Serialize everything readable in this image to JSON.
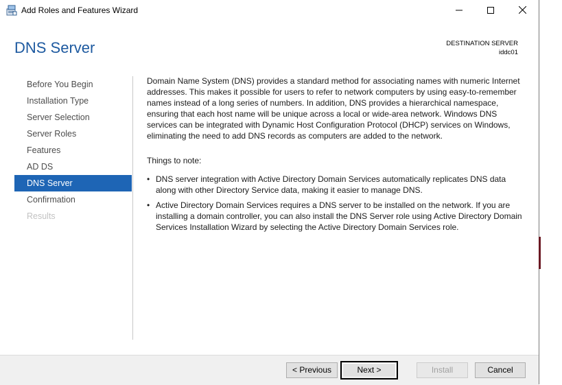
{
  "window": {
    "title": "Add Roles and Features Wizard",
    "minimize_label": "Minimize",
    "maximize_label": "Maximize",
    "close_label": "Close"
  },
  "header": {
    "page_title": "DNS Server",
    "destination_label": "DESTINATION SERVER",
    "destination_server": "iddc01"
  },
  "nav": {
    "items": [
      {
        "label": "Before You Begin",
        "state": "normal"
      },
      {
        "label": "Installation Type",
        "state": "normal"
      },
      {
        "label": "Server Selection",
        "state": "normal"
      },
      {
        "label": "Server Roles",
        "state": "normal"
      },
      {
        "label": "Features",
        "state": "normal"
      },
      {
        "label": "AD DS",
        "state": "normal"
      },
      {
        "label": "DNS Server",
        "state": "active"
      },
      {
        "label": "Confirmation",
        "state": "normal"
      },
      {
        "label": "Results",
        "state": "disabled"
      }
    ]
  },
  "content": {
    "intro": "Domain Name System (DNS) provides a standard method for associating names with numeric Internet addresses. This makes it possible for users to refer to network computers by using easy-to-remember names instead of a long series of numbers. In addition, DNS provides a hierarchical namespace, ensuring that each host name will be unique across a local or wide-area network. Windows DNS services can be integrated with Dynamic Host Configuration Protocol (DHCP) services on Windows, eliminating the need to add DNS records as computers are added to the network.",
    "notes_heading": "Things to note:",
    "notes": [
      "DNS server integration with Active Directory Domain Services automatically replicates DNS data along with other Directory Service data, making it easier to manage DNS.",
      "Active Directory Domain Services requires a DNS server to be installed on the network. If you are installing a domain controller, you can also install the DNS Server role using Active Directory Domain Services Installation Wizard by selecting the Active Directory Domain Services role."
    ],
    "bullet": "•"
  },
  "footer": {
    "previous_label": "< Previous",
    "next_label": "Next >",
    "install_label": "Install",
    "cancel_label": "Cancel"
  },
  "colors": {
    "title_blue": "#1e5aa0",
    "active_nav": "#1e65b5"
  }
}
